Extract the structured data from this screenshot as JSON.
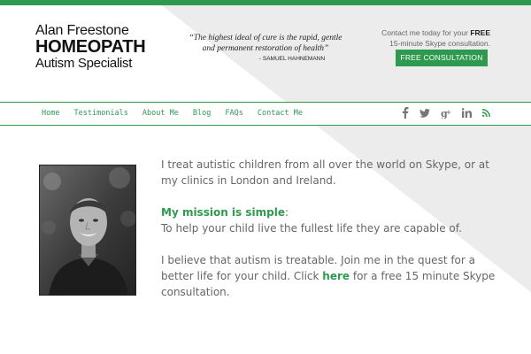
{
  "header": {
    "logo": {
      "line1": "Alan Freestone",
      "line2": "HOMEOPATH",
      "line3": "Autism Specialist"
    },
    "quote": {
      "text": "“The highest ideal of cure is the rapid, gentle and permanent restoration of health”",
      "author": "- SAMUEL HAHNEMANN"
    },
    "cta": {
      "line1_prefix": "Contact me today for your ",
      "line1_bold": "FREE",
      "line2": "15-minute Skype consultation.",
      "button_label": "FREE CONSULTATION"
    }
  },
  "nav": {
    "items": [
      {
        "label": "Home"
      },
      {
        "label": "Testimonials"
      },
      {
        "label": "About Me"
      },
      {
        "label": "Blog"
      },
      {
        "label": "FAQs"
      },
      {
        "label": "Contact Me"
      }
    ],
    "social_icons": [
      "facebook-icon",
      "twitter-icon",
      "google-plus-icon",
      "linkedin-icon",
      "rss-icon"
    ]
  },
  "main": {
    "intro": "I treat autistic children from all over the world on Skype, or at my clinics in London and Ireland.",
    "mission_heading": "My mission is simple",
    "mission_colon": ":",
    "mission_text": "To help your child live the fullest life they are capable of.",
    "belief_before": "I believe that autism is treatable. Join me in the quest for a better life for your child. Click ",
    "belief_link": "here",
    "belief_after": " for a free 15 minute Skype consultation."
  },
  "colors": {
    "accent": "#2e9a4f",
    "text": "#666666",
    "background": "#f2f2f2"
  }
}
